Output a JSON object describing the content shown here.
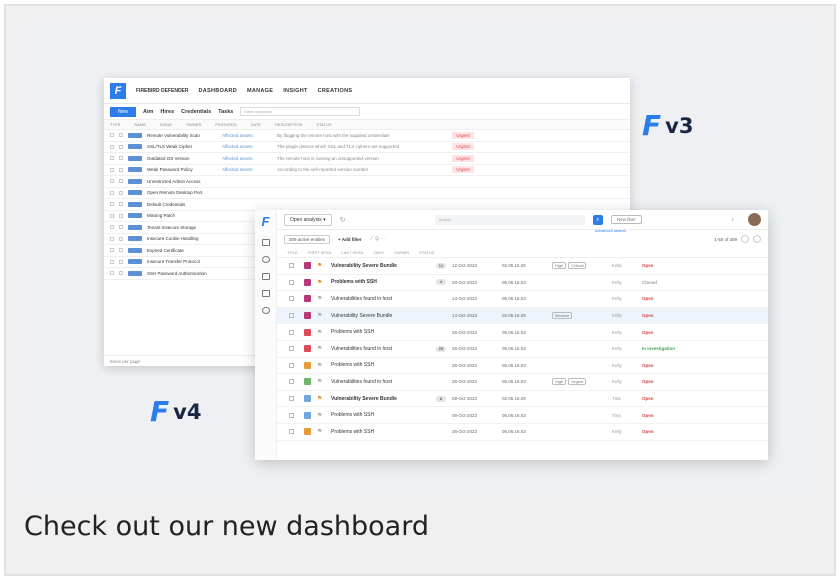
{
  "caption": "Check out our new dashboard",
  "brand_color": "#2b7de9",
  "labels": {
    "v3": "v3",
    "v4": "v4"
  },
  "v3": {
    "logo_letter": "F",
    "brand": "FIREBIRD DEFENDER",
    "nav": [
      "DASHBOARD",
      "MANAGE",
      "INSIGHT",
      "CREATIONS"
    ],
    "new_button": "New",
    "toolbar": [
      "Aim",
      "Hires",
      "Credentials",
      "Tasks"
    ],
    "search_placeholder": "Enter keywords",
    "header": [
      "TYPE",
      "NAME",
      "ISSUE",
      "OWNER",
      "FEATURED",
      "DATE",
      "DESCRIPTION",
      "STATUS"
    ],
    "rows": [
      {
        "name": "Remote Vulnerability Scan",
        "link": "Affected assets",
        "desc": "By flagging the remote host with the supplied credentials",
        "status": "Urgent"
      },
      {
        "name": "SSL/TLS Weak Cipher",
        "link": "Affected assets",
        "desc": "The plugin detects which SSL and TLS ciphers are supported",
        "status": "Urgent"
      },
      {
        "name": "Outdated OS Version",
        "link": "Affected assets",
        "desc": "The remote host is running an unsupported version",
        "status": "Urgent"
      },
      {
        "name": "Weak Password Policy",
        "link": "Affected assets",
        "desc": "According to the self-reported version number",
        "status": "Urgent"
      },
      {
        "name": "Unrestricted Admin Access",
        "link": "",
        "desc": "",
        "status": ""
      },
      {
        "name": "Open Remote Desktop Port",
        "link": "",
        "desc": "",
        "status": ""
      },
      {
        "name": "Default Credentials",
        "link": "",
        "desc": "",
        "status": ""
      },
      {
        "name": "Missing Patch",
        "link": "",
        "desc": "",
        "status": ""
      },
      {
        "name": "Tenant Insecure Storage",
        "link": "",
        "desc": "",
        "status": ""
      },
      {
        "name": "Insecure Cookie Handling",
        "link": "",
        "desc": "",
        "status": ""
      },
      {
        "name": "Expired Certificate",
        "link": "",
        "desc": "",
        "status": ""
      },
      {
        "name": "Insecure Transfer Protocol",
        "link": "",
        "desc": "",
        "status": ""
      },
      {
        "name": "SSH Password Authentication",
        "link": "",
        "desc": "",
        "status": ""
      }
    ],
    "footer": "Items per page"
  },
  "v4": {
    "logo_letter": "F",
    "view_select": "Open analysis ▾",
    "search_placeholder": "Search",
    "new_button": "New filter",
    "advanced_search": "Advanced search",
    "filter_chip": "309 active entities",
    "add_filter": "+ Add filter",
    "pager": "1-50 of 309",
    "header": [
      "TITLE",
      "FIRST SEEN",
      "LAST SEEN",
      "TAGS",
      "OWNER",
      "STATUS"
    ],
    "rows": [
      {
        "sq": "#b8377a",
        "flag": "#d8902a",
        "title": "Vulnerability Severe Bundle",
        "bold": true,
        "cnt": "12",
        "d1": "12-Oct-2023",
        "d2": "02.05.16.09",
        "tags": [
          "High",
          "Critical"
        ],
        "user": "Kelly",
        "status": "Open",
        "status_color": "#d84040",
        "sel": false
      },
      {
        "sq": "#b8377a",
        "flag": "#d8902a",
        "title": "Problems with SSH",
        "bold": true,
        "cnt": "4",
        "d1": "28-Oct-2023",
        "d2": "06.06.16.03",
        "tags": [],
        "user": "Kelly",
        "status": "Closed",
        "status_color": "#999999",
        "sel": false
      },
      {
        "sq": "#b8377a",
        "flag": "#aaaaaa",
        "title": "Vulnerabilities found in host",
        "bold": false,
        "cnt": "",
        "d1": "14-Oct-2023",
        "d2": "06.06.16.03",
        "tags": [],
        "user": "Kelly",
        "status": "Open",
        "status_color": "#d84040",
        "sel": false
      },
      {
        "sq": "#b8377a",
        "flag": "#aaaaaa",
        "title": "Vulnerability Severe Bundle",
        "bold": false,
        "cnt": "",
        "d1": "14-Oct-2023",
        "d2": "02.05.16.09",
        "tags": [
          "Medium"
        ],
        "user": "Kelly",
        "status": "Open",
        "status_color": "#d84040",
        "sel": true
      },
      {
        "sq": "#e24a5a",
        "flag": "#aaaaaa",
        "title": "Problems with SSH",
        "bold": false,
        "cnt": "",
        "d1": "26-Oct-2023",
        "d2": "06.06.16.03",
        "tags": [],
        "user": "Kelly",
        "status": "Open",
        "status_color": "#d84040",
        "sel": false
      },
      {
        "sq": "#e24a5a",
        "flag": "#aaaaaa",
        "title": "Vulnerabilities found in host",
        "bold": false,
        "cnt": "28",
        "d1": "26-Oct-2023",
        "d2": "06.06.16.03",
        "tags": [],
        "user": "Kelly",
        "status": "In investigation",
        "status_color": "#3fa34d",
        "sel": false
      },
      {
        "sq": "#e89a3a",
        "flag": "#aaaaaa",
        "title": "Problems with SSH",
        "bold": false,
        "cnt": "",
        "d1": "26-Oct-2023",
        "d2": "06.06.16.03",
        "tags": [],
        "user": "Kelly",
        "status": "Open",
        "status_color": "#d84040",
        "sel": false
      },
      {
        "sq": "#6fb56f",
        "flag": "#aaaaaa",
        "title": "Vulnerabilities found in host",
        "bold": false,
        "cnt": "",
        "d1": "26-Oct-2023",
        "d2": "06.06.16.03",
        "tags": [
          "High",
          "Urgent"
        ],
        "user": "Kelly",
        "status": "Open",
        "status_color": "#d84040",
        "sel": false
      },
      {
        "sq": "#6fa5e0",
        "flag": "#d8902a",
        "title": "Vulnerability Severe Bundle",
        "bold": true,
        "cnt": "8",
        "d1": "09-Oct-2023",
        "d2": "02.05.16.09",
        "tags": [],
        "user": "Tina",
        "status": "Open",
        "status_color": "#d84040",
        "sel": false
      },
      {
        "sq": "#6fa5e0",
        "flag": "#aaaaaa",
        "title": "Problems with SSH",
        "bold": false,
        "cnt": "",
        "d1": "09-Oct-2023",
        "d2": "06.06.16.03",
        "tags": [],
        "user": "Tina",
        "status": "Open",
        "status_color": "#d84040",
        "sel": false
      },
      {
        "sq": "#e89a3a",
        "flag": "#aaaaaa",
        "title": "Problems with SSH",
        "bold": false,
        "cnt": "",
        "d1": "26-Oct-2023",
        "d2": "06.06.16.03",
        "tags": [],
        "user": "Kelly",
        "status": "Open",
        "status_color": "#d84040",
        "sel": false
      }
    ]
  }
}
